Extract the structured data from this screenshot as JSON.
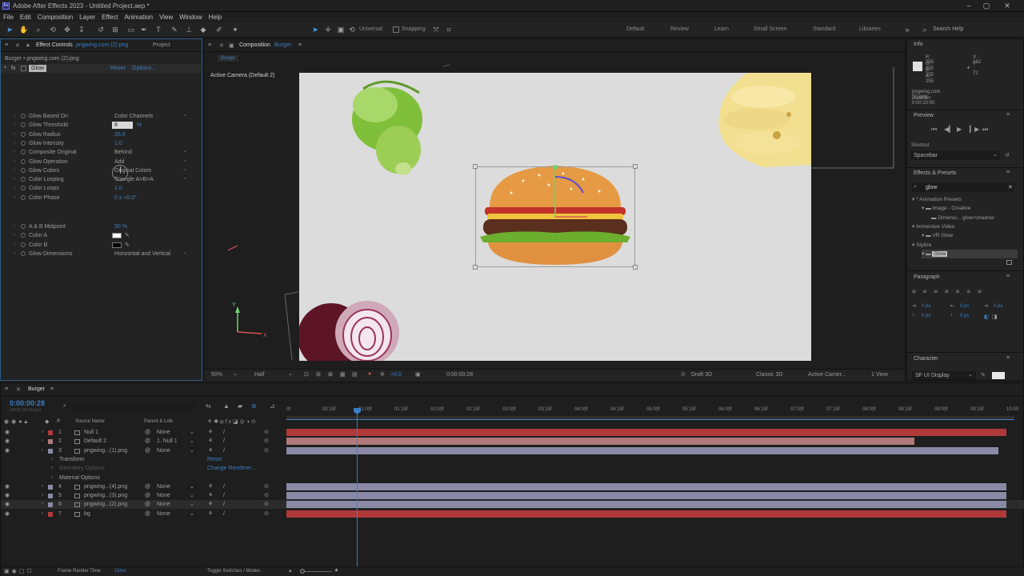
{
  "window": {
    "title": "Adobe After Effects 2023 - Untitled Project.aep *",
    "app_icon": "Ae"
  },
  "menu": [
    "File",
    "Edit",
    "Composition",
    "Layer",
    "Effect",
    "Animation",
    "View",
    "Window",
    "Help"
  ],
  "toolbar": {
    "universal": "Universal",
    "snapping": "Snapping"
  },
  "workspaces": [
    "Default",
    "Review",
    "Learn",
    "Small Screen",
    "Standard",
    "Libraries"
  ],
  "search_help": "Search Help",
  "effect_controls": {
    "tab": "Effect Controls",
    "tab_file": "pngwing.com (2).png",
    "tab_project": "Project",
    "layer_path": "Burger • pngwing.com (2).png",
    "effect_name": "Glow",
    "reset": "Reset",
    "options": "Options...",
    "props": [
      {
        "label": "Glow Based On",
        "value": "Color Channels",
        "kind": "dropdown"
      },
      {
        "label": "Glow Threshold",
        "value": "8",
        "unit": "%",
        "kind": "edit"
      },
      {
        "label": "Glow Radius",
        "value": "26.0",
        "kind": "value"
      },
      {
        "label": "Glow Intensity",
        "value": "1.0",
        "kind": "value"
      },
      {
        "label": "Composite Original",
        "value": "Behind",
        "kind": "dropdown"
      },
      {
        "label": "Glow Operation",
        "value": "Add",
        "kind": "dropdown"
      },
      {
        "label": "Glow Colors",
        "value": "Original Colors",
        "kind": "dropdown"
      },
      {
        "label": "Color Looping",
        "value": "Triangle A>B>A",
        "kind": "dropdown"
      },
      {
        "label": "Color Loops",
        "value": "1.0",
        "kind": "value"
      },
      {
        "label": "Color Phase",
        "value": "0 x +0.0°",
        "kind": "value"
      }
    ],
    "props2": [
      {
        "label": "A & B Midpoint",
        "value": "50 %",
        "kind": "value"
      },
      {
        "label": "Color A",
        "value": "",
        "kind": "color",
        "color": "#ffffff"
      },
      {
        "label": "Color B",
        "value": "",
        "kind": "color",
        "color": "#000000"
      },
      {
        "label": "Glow Dimensions",
        "value": "Horizontal and Vertical",
        "kind": "dropdown"
      }
    ]
  },
  "composition": {
    "tab": "Composition",
    "tab_name": "Burger",
    "breadcrumb": "Burger",
    "camera_label": "Active Camera (Default 2)",
    "footer": {
      "zoom": "50%",
      "resolution": "Half",
      "exposure": "+0.0",
      "timecode": "0:00:00:28",
      "draft3d": "Draft 3D",
      "renderer": "Classic 3D",
      "camera": "Active Camer...",
      "views": "1 View"
    }
  },
  "info": {
    "title": "Info",
    "r": "R : 255",
    "g": "G : 255",
    "b": "B : 255",
    "a": "A : 255",
    "x": "X : 162",
    "y": "Y : 72",
    "file": "pngwing.com (2).png",
    "duration": "Duration: 0:00:10:00"
  },
  "preview": {
    "title": "Preview",
    "shortcut_label": "Shortcut",
    "shortcut": "Spacebar"
  },
  "effects_presets": {
    "title": "Effects & Presets",
    "search": "glow",
    "tree": [
      {
        "text": "* Animation Presets",
        "indent": 0
      },
      {
        "text": "Image - Creative",
        "indent": 1
      },
      {
        "text": "Dimensi... glow+shadow",
        "indent": 2
      },
      {
        "text": "Immersive Video",
        "indent": 0
      },
      {
        "text": "VR Glow",
        "indent": 1
      },
      {
        "text": "Stylize",
        "indent": 0
      },
      {
        "text": "Glow",
        "indent": 1,
        "selected": true
      }
    ]
  },
  "paragraph": {
    "title": "Paragraph",
    "fields": [
      "0 px",
      "0 px",
      "0 px",
      "0 px",
      "0 px"
    ]
  },
  "character": {
    "title": "Character",
    "font": "SF UI Display"
  },
  "timeline": {
    "tab": "Burger",
    "timecode": "0:00:00:28",
    "timecode_sub": "00028 (30.00 fps)",
    "col_source": "Source Name",
    "col_parent": "Parent & Link",
    "ruler": [
      "0f",
      "00:15f",
      "01:00f",
      "01:15f",
      "02:00f",
      "02:15f",
      "03:00f",
      "03:15f",
      "04:00f",
      "04:15f",
      "05:00f",
      "05:15f",
      "06:00f",
      "06:15f",
      "07:00f",
      "07:15f",
      "08:00f",
      "08:15f",
      "09:00f",
      "09:15f",
      "10:00"
    ],
    "layers": [
      {
        "num": "1",
        "name": "Null 1",
        "parent": "None",
        "color": "#b03a3a"
      },
      {
        "num": "2",
        "name": "Default 2",
        "parent": "1. Null 1",
        "color": "#b07a7a"
      },
      {
        "num": "3",
        "name": "pngwing...(1).png",
        "parent": "None",
        "color": "#8a8aa6"
      },
      {
        "num": "4",
        "name": "pngwing...(4).png",
        "parent": "None",
        "color": "#8a8aa6"
      },
      {
        "num": "5",
        "name": "pngwing...(3).png",
        "parent": "None",
        "color": "#8a8aa6"
      },
      {
        "num": "6",
        "name": "pngwing...(2).png",
        "parent": "None",
        "color": "#8a8aa6"
      },
      {
        "num": "7",
        "name": "bg",
        "parent": "None",
        "color": "#b03a3a"
      }
    ],
    "sub_props": [
      "Transform",
      "Geometry Options",
      "Material Options"
    ],
    "reset": "Reset",
    "change_renderer": "Change Renderer...",
    "frame_render_label": "Frame Render Time:",
    "frame_render_value": "16ms",
    "toggle_label": "Toggle Switches / Modes"
  }
}
